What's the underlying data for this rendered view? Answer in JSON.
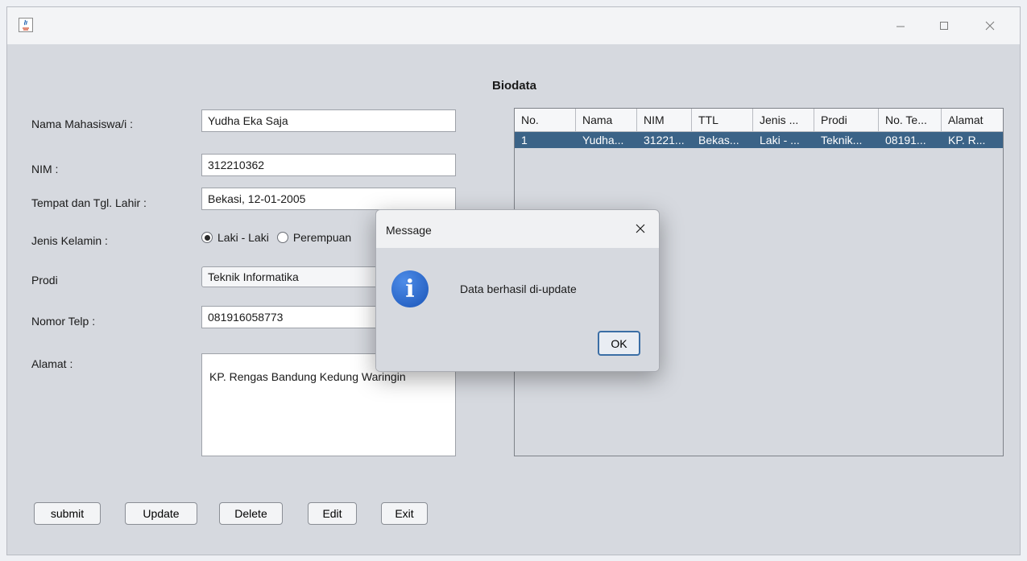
{
  "window": {
    "title": ""
  },
  "form": {
    "title": "Biodata",
    "labels": {
      "nama": "Nama Mahasiswa/i  :",
      "nim": "NIM :",
      "ttl": "Tempat dan Tgl. Lahir :",
      "jenis_kelamin": "Jenis Kelamin :",
      "prodi": "Prodi",
      "telp": "Nomor Telp :",
      "alamat": "Alamat :"
    },
    "values": {
      "nama": "Yudha Eka Saja",
      "nim": "312210362",
      "ttl": "Bekasi, 12-01-2005",
      "prodi": "Teknik Informatika",
      "telp": "081916058773",
      "alamat": "KP. Rengas Bandung Kedung Waringin"
    },
    "gender": {
      "option1": "Laki - Laki",
      "option2": "Perempuan",
      "selected": "Laki - Laki"
    }
  },
  "buttons": {
    "submit": "submit",
    "update": "Update",
    "delete": "Delete",
    "edit": "Edit",
    "exit": "Exit"
  },
  "table": {
    "headers": [
      "No.",
      "Nama",
      "NIM",
      "TTL",
      "Jenis ...",
      "Prodi",
      "No. Te...",
      "Alamat"
    ],
    "rows": [
      [
        "1",
        "Yudha...",
        "31221...",
        "Bekas...",
        "Laki - ...",
        "Teknik...",
        "08191...",
        "KP. R..."
      ]
    ]
  },
  "dialog": {
    "title": "Message",
    "message": "Data berhasil di-update",
    "ok_label": "OK",
    "icon": "info-icon"
  },
  "colors": {
    "selection": "#3b6387",
    "background": "#d6d9df",
    "info_blue": "#1b55b8"
  }
}
